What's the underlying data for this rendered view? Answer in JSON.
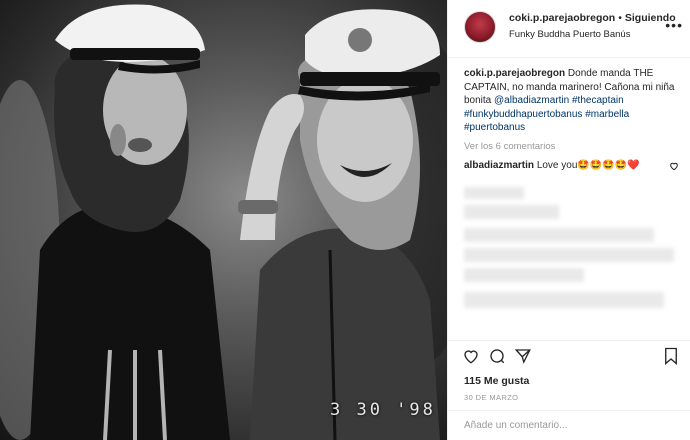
{
  "post": {
    "author": "coki.p.parejaobregon",
    "separator": "•",
    "follow_label": "Siguiendo",
    "location": "Funky Buddha Puerto Banús",
    "more_label": "•••"
  },
  "caption": {
    "user": "coki.p.parejaobregon",
    "text_1": " Donde manda THE CAPTAIN, no manda marinero! Cañona mi niña bonita ",
    "mention": "@albadiazmartin",
    "tags": [
      "#thecaptain",
      "#funkybuddhapuertobanus",
      "#marbella",
      "#puertobanus"
    ]
  },
  "view_all_comments": "Ver los 6 comentarios",
  "comment": {
    "user": "albadiazmartin",
    "text": "Love you🤩🤩🤩🤩❤️"
  },
  "likes": "115 Me gusta",
  "date": "30 DE MARZO",
  "add_comment_placeholder": "Añade un comentario...",
  "photo": {
    "date_stamp": "3 30 '98"
  },
  "icons": {
    "like": "heart-icon",
    "comment": "comment-icon",
    "share": "share-icon",
    "save": "bookmark-icon",
    "comment_like": "heart-icon"
  }
}
